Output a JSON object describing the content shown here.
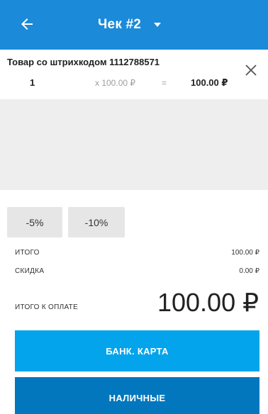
{
  "appbar": {
    "title": "Чек #2",
    "back_icon": "arrow-left-icon",
    "dropdown_icon": "caret-down-icon",
    "color": "#1b8ad9"
  },
  "item": {
    "name": "Товар со штрихкодом 1112788571",
    "quantity": "1",
    "price": "x 100.00 ₽",
    "equals": "=",
    "sum": "100.00 ₽",
    "remove_icon": "close-icon"
  },
  "discounts": [
    {
      "label": "-5%"
    },
    {
      "label": "-10%"
    }
  ],
  "summary": {
    "total_label": "ИТОГО",
    "total_value": "100.00 ₽",
    "discount_label": "СКИДКА",
    "discount_value": "0.00 ₽",
    "to_pay_label": "ИТОГО К ОПЛАТЕ",
    "to_pay_value": "100.00 ₽"
  },
  "payment": {
    "card_label": "БАНК. КАРТА",
    "cash_label": "НАЛИЧНЫЕ",
    "card_color": "#03a4eb",
    "cash_color": "#0277bd"
  }
}
